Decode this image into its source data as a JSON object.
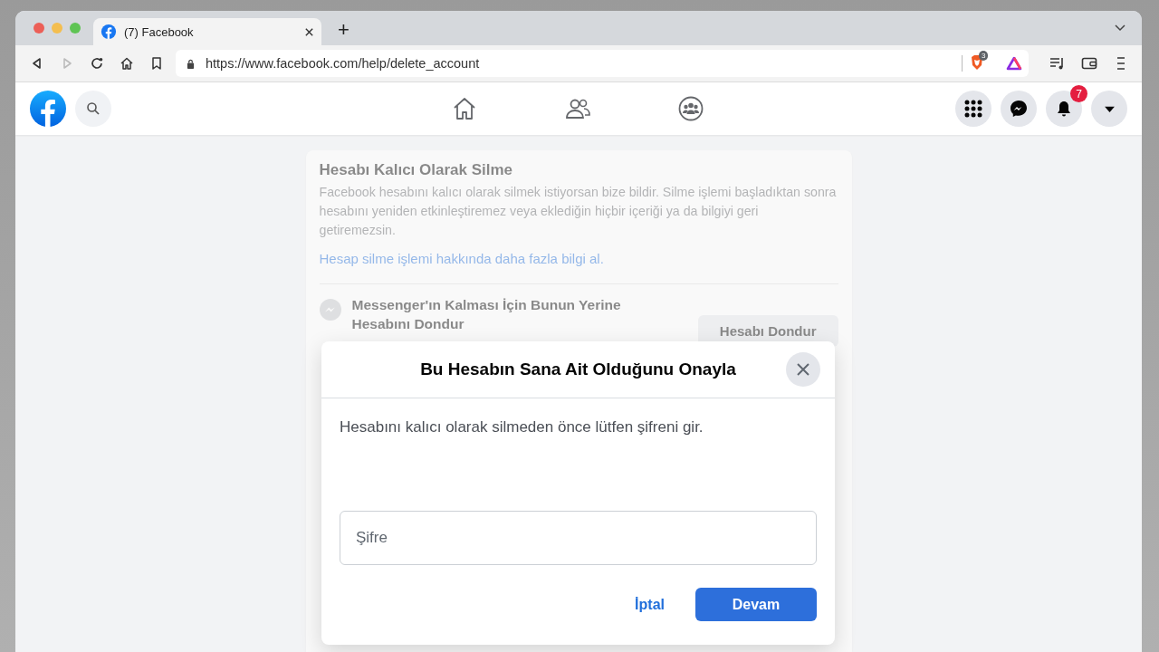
{
  "browser": {
    "tab": {
      "title": "(7) Facebook"
    },
    "new_tab": "+",
    "url": "https://www.facebook.com/help/delete_account",
    "shields_badge": "3"
  },
  "header": {
    "notifications_badge": "7"
  },
  "page": {
    "title": "Hesabı Kalıcı Olarak Silme",
    "description": "Facebook hesabını kalıcı olarak silmek istiyorsan bize bildir. Silme işlemi başladıktan sonra hesabını yeniden etkinleştiremez veya eklediğin hiçbir içeriği ya da bilgiyi geri getiremezsin.",
    "link": "Hesap silme işlemi hakkında daha fazla bilgi al.",
    "option": {
      "title": "Messenger'ın Kalması İçin Bunun Yerine Hesabını Dondur",
      "button": "Hesabı Dondur"
    }
  },
  "modal": {
    "title": "Bu Hesabın Sana Ait Olduğunu Onayla",
    "message": "Hesabını kalıcı olarak silmeden önce lütfen şifreni gir.",
    "password": {
      "placeholder": "Şifre"
    },
    "cancel": "İptal",
    "continue": "Devam"
  }
}
